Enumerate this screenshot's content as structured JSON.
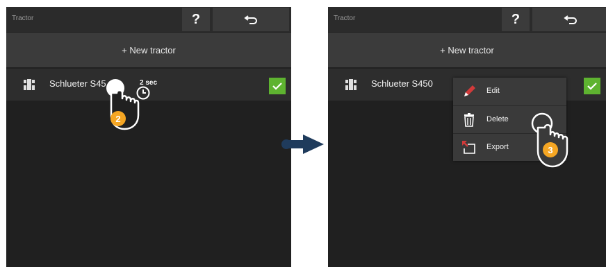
{
  "left": {
    "title": "Tractor",
    "help_label": "?",
    "new_label": "+ New tractor",
    "tractor_name": "Schlueter S45",
    "hold_duration": "2 sec",
    "step_number": "2"
  },
  "right": {
    "title": "Tractor",
    "help_label": "?",
    "new_label": "+ New tractor",
    "tractor_name": "Schlueter S450",
    "menu": [
      {
        "label": "Edit",
        "icon": "pencil-icon"
      },
      {
        "label": "Delete",
        "icon": "trash-icon"
      },
      {
        "label": "Export",
        "icon": "export-icon"
      }
    ],
    "step_number": "3"
  },
  "colors": {
    "panel_bg": "#202020",
    "bar_bg": "#3b3b3b",
    "check_green": "#5eb330",
    "badge_orange": "#f5a623",
    "arrow": "#1f3b5c"
  }
}
